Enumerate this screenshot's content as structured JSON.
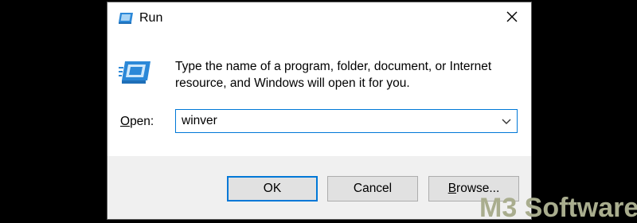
{
  "window": {
    "title": "Run",
    "description": "Type the name of a program, folder, document, or Internet resource, and Windows will open it for you."
  },
  "open_field": {
    "label_prefix": "O",
    "label_rest": "pen:",
    "value": "winver"
  },
  "buttons": {
    "ok": "OK",
    "cancel": "Cancel",
    "browse_prefix": "B",
    "browse_rest": "rowse..."
  },
  "watermark": {
    "text_a": "M3",
    "text_b": " Software"
  },
  "colors": {
    "accent": "#0078d7",
    "footer_bg": "#f0f0f0",
    "button_bg": "#e1e1e1",
    "watermark": "#a9ad8e"
  },
  "icons": {
    "title": "run-icon",
    "close": "close-icon",
    "big": "run-icon",
    "dropdown": "chevron-down-icon"
  }
}
